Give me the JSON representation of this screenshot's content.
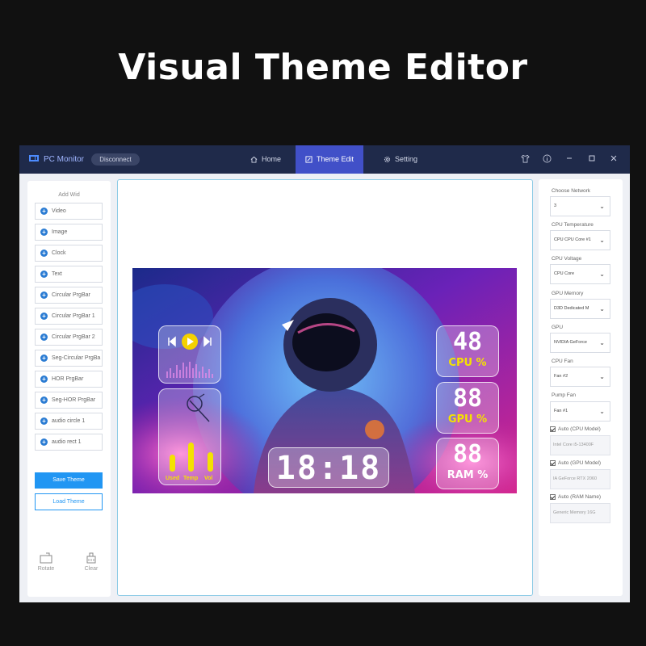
{
  "headline": "Visual Theme Editor",
  "app": {
    "title": "PC Monitor",
    "disconnect_label": "Disconnect",
    "tabs": [
      {
        "label": "Home",
        "icon": "home-icon"
      },
      {
        "label": "Theme Edit",
        "icon": "theme-edit-icon",
        "active": true
      },
      {
        "label": "Setting",
        "icon": "gear-icon"
      }
    ],
    "accent_color": "#4150c8",
    "titlebar_color": "#1f2a4a"
  },
  "left_panel": {
    "heading": "Add Wid",
    "widgets": [
      "Video",
      "Image",
      "Clock",
      "Text",
      "Circular PrgBar",
      "Circular PrgBar 1",
      "Circular PrgBar 2",
      "Seg-Circular PrgBa",
      "HOR PrgBar",
      "Seg-HOR PrgBar",
      "audio circle 1",
      "audio rect 1"
    ],
    "save_label": "Save Theme",
    "load_label": "Load Theme",
    "rotate_label": "Rotate",
    "clear_label": "Clear"
  },
  "preview": {
    "cpu_value": "48",
    "cpu_label": "CPU  %",
    "gpu_value": "88",
    "gpu_label": "GPU  %",
    "ram_value": "88",
    "ram_label": "RAM  %",
    "clock": "18:18",
    "gauge_labels": [
      "Used",
      "Temp",
      "Vol"
    ],
    "gauge_levels": [
      0.35,
      0.6,
      0.4
    ],
    "accent_yellow": "#f4e200"
  },
  "right_panel": {
    "network_label": "Choose Network",
    "network_value": "3",
    "cpu_temp_label": "CPU Temperature",
    "cpu_temp_value": "CPU CPU Core #1",
    "cpu_voltage_label": "CPU Voltage",
    "cpu_voltage_value": "CPU Core",
    "gpu_memory_label": "GPU Memory",
    "gpu_memory_value": "D3D Dedicated M",
    "gpu_label": "GPU",
    "gpu_value": "NVIDIA GeForce",
    "cpu_fan_label": "CPU Fan",
    "cpu_fan_value": "Fan #2",
    "pump_fan_label": "Pump Fan",
    "pump_fan_value": "Fan #1",
    "auto_cpu_label": "Auto (CPU Model)",
    "auto_cpu_value": "Intel Core i5-13400F",
    "auto_gpu_label": "Auto (GPU Model)",
    "auto_gpu_value": "IA GeForce RTX 2060",
    "auto_ram_label": "Auto (RAM Name)",
    "auto_ram_value": "Generic Memory 16G"
  }
}
